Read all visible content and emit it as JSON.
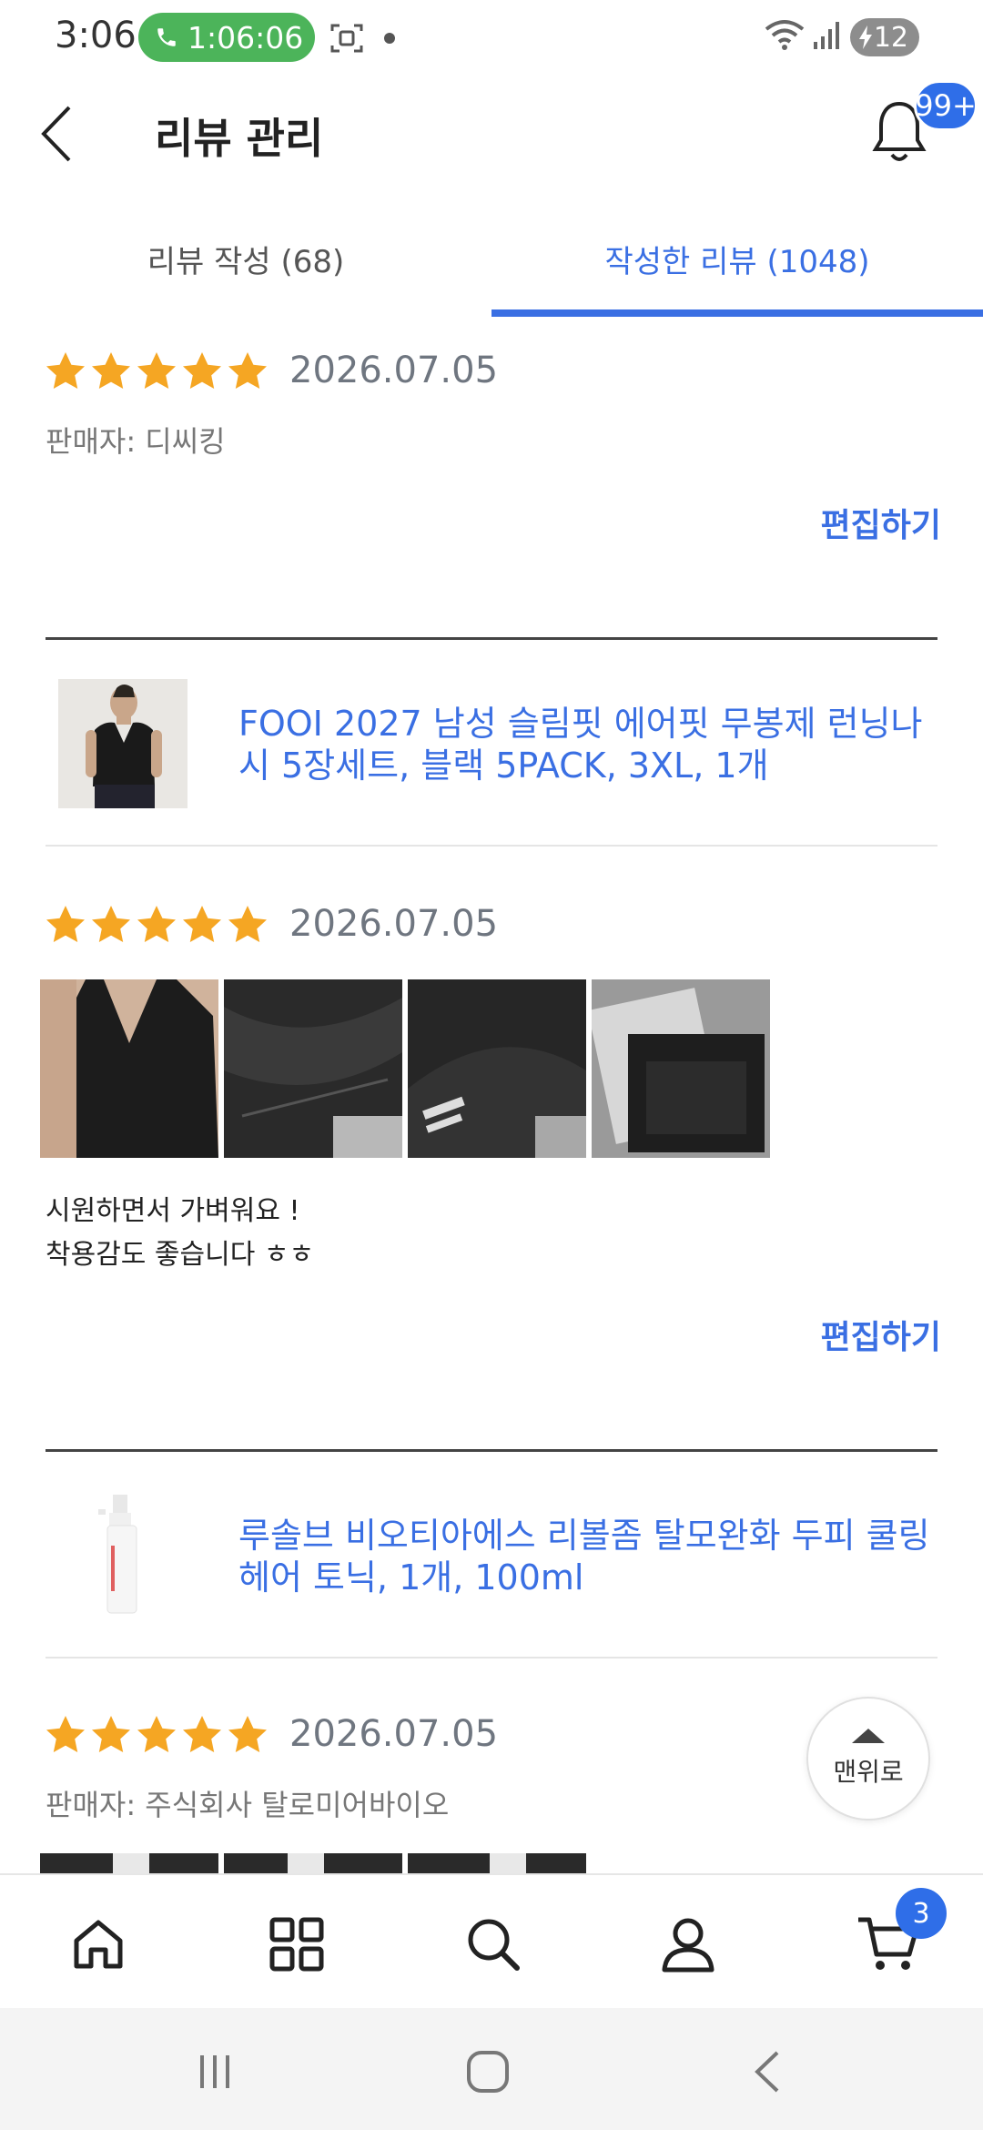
{
  "status_bar": {
    "time": "3:06",
    "call_timer": "1:06:06",
    "battery_level": "12"
  },
  "header": {
    "title": "리뷰 관리",
    "notification_badge": "99+"
  },
  "tabs": [
    {
      "label": "리뷰 작성 (68)",
      "active": false
    },
    {
      "label": "작성한 리뷰 (1048)",
      "active": true
    }
  ],
  "reviews": [
    {
      "rating": 5,
      "date": "2026.07.05",
      "seller": "판매자: 디씨킹",
      "edit_label": "편집하기"
    },
    {
      "product_title": "FOOI 2027 남성 슬림핏 에어핏 무봉제 런닝나시 5장세트, 블랙 5PACK, 3XL, 1개",
      "rating": 5,
      "date": "2026.07.05",
      "review_text_line1": "시원하면서 가벼워요 !",
      "review_text_line2": "착용감도 좋습니다 ㅎㅎ",
      "edit_label": "편집하기"
    },
    {
      "product_title": "루솔브 비오티아에스 리볼좀 탈모완화 두피 쿨링 헤어 토닉, 1개, 100ml",
      "rating": 5,
      "date": "2026.07.05",
      "seller": "판매자: 주식회사 탈로미어바이오"
    }
  ],
  "scroll_top_label": "맨위로",
  "bottom_nav": {
    "items": [
      "home-icon",
      "category-grid-icon",
      "search-icon",
      "user-icon",
      "cart-icon"
    ],
    "cart_badge": "3"
  },
  "colors": {
    "accent": "#3a6fe3",
    "star": "#f5a623",
    "badge": "#2f6ee8"
  }
}
